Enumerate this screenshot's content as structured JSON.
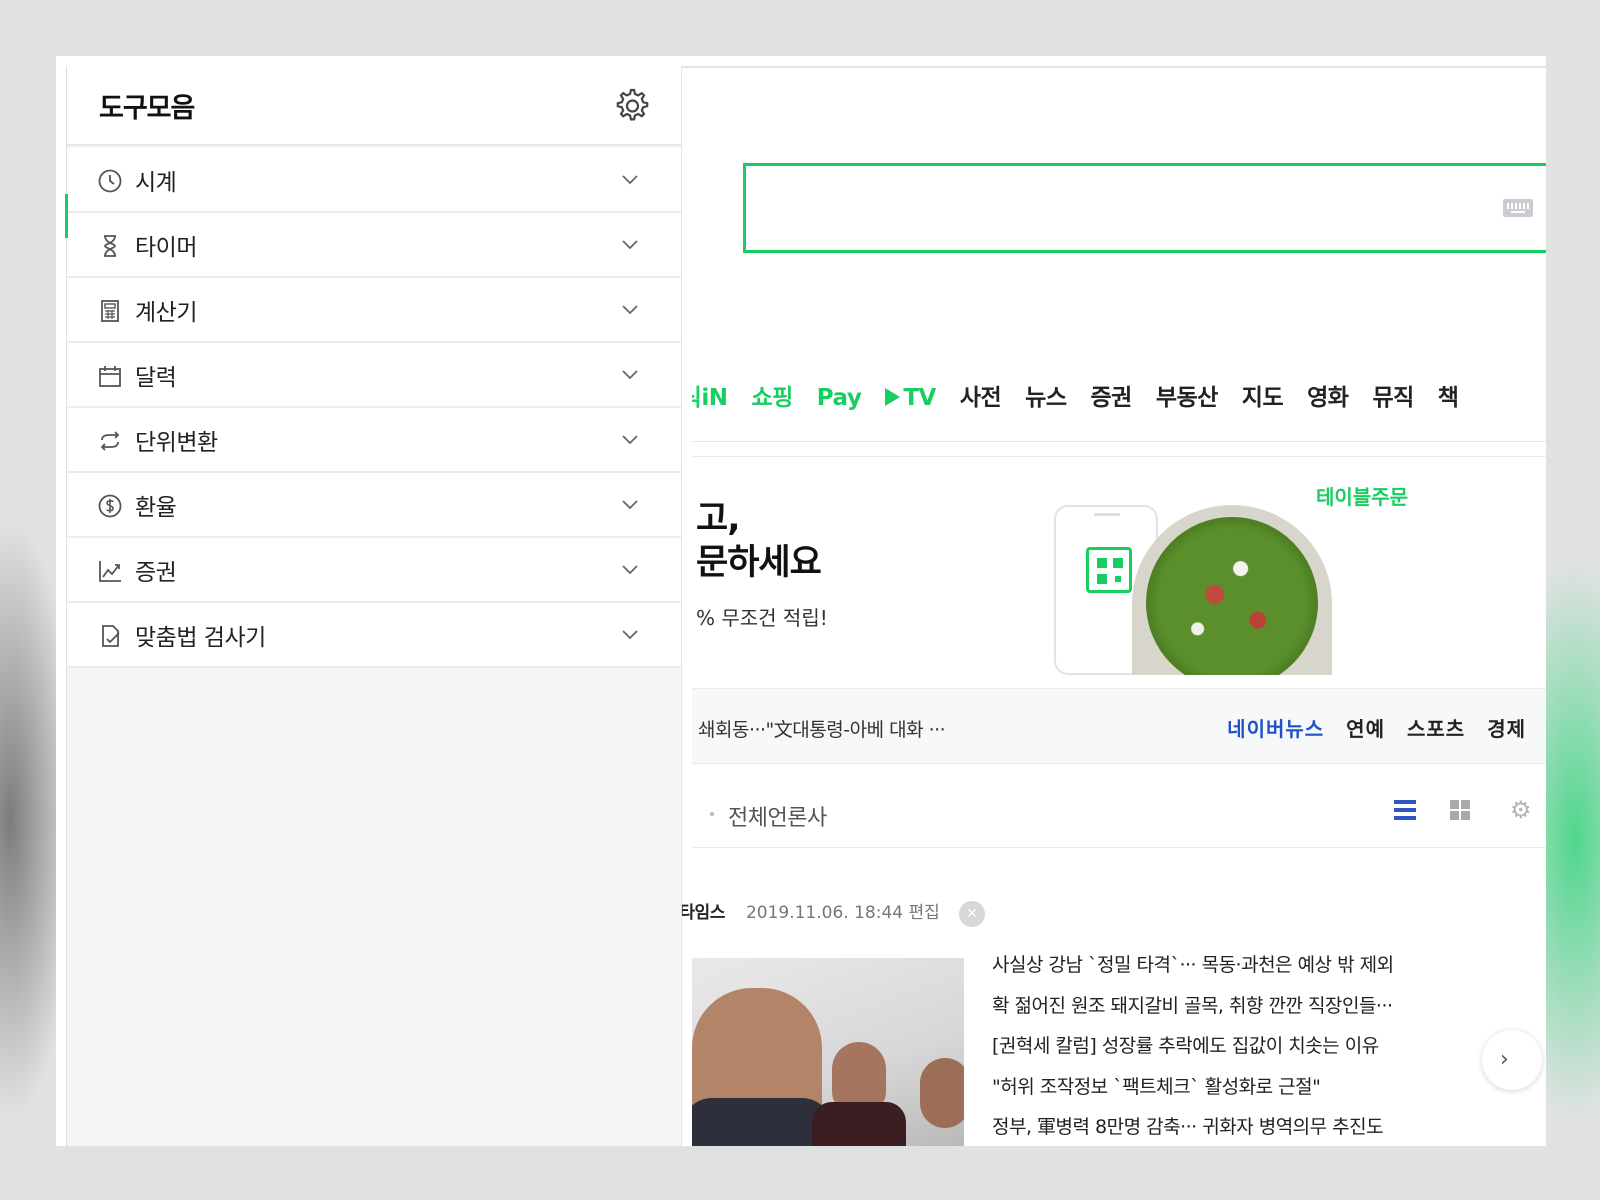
{
  "panel": {
    "title": "도구모음",
    "tools": [
      {
        "label": "시계",
        "icon": "clock-icon"
      },
      {
        "label": "타이머",
        "icon": "hourglass-icon"
      },
      {
        "label": "계산기",
        "icon": "calculator-icon"
      },
      {
        "label": "달력",
        "icon": "calendar-icon"
      },
      {
        "label": "단위변환",
        "icon": "convert-icon"
      },
      {
        "label": "환율",
        "icon": "dollar-icon"
      },
      {
        "label": "증권",
        "icon": "stock-chart-icon"
      },
      {
        "label": "맞춤법 검사기",
        "icon": "spell-check-icon"
      }
    ]
  },
  "nav": {
    "items": [
      {
        "label": "지식iN",
        "green": true
      },
      {
        "label": "쇼핑",
        "green": true
      },
      {
        "label": "Pay",
        "green": true
      },
      {
        "label": "TV",
        "green": true
      },
      {
        "label": "사전",
        "green": false
      },
      {
        "label": "뉴스",
        "green": false
      },
      {
        "label": "증권",
        "green": false
      },
      {
        "label": "부동산",
        "green": false
      },
      {
        "label": "지도",
        "green": false
      },
      {
        "label": "영화",
        "green": false
      },
      {
        "label": "뮤직",
        "green": false
      },
      {
        "label": "책",
        "green": false
      }
    ]
  },
  "banner": {
    "title_line1": "고,",
    "title_line2": "문하세요",
    "subtitle": "% 무조건 적립!",
    "brand": "테이블주문"
  },
  "news": {
    "ticker": "쇄회동···\"文대통령-아베 대화 ···",
    "tabs": [
      "네이버뉴스",
      "연예",
      "스포츠",
      "경제"
    ],
    "press_filter": "전체언론사",
    "press_name": "헤럴드타임스",
    "date": "2019.11.06. 18:44 편집",
    "headlines": [
      "사실상 강남 `정밀 타격`··· 목동·과천은 예상 밖 제외",
      "확 젊어진 원조 돼지갈비 골목, 취향 깐깐 직장인들···",
      "[권혁세 칼럼] 성장률 추락에도 집값이 치솟는 이유",
      "\"허위 조작정보 `팩트체크` 활성화로 근절\"",
      "정부, 軍병력 8만명 감축··· 귀화자 병역의무 추진도"
    ]
  },
  "colors": {
    "naver_green": "#19ce60",
    "news_blue": "#1f52c6"
  }
}
